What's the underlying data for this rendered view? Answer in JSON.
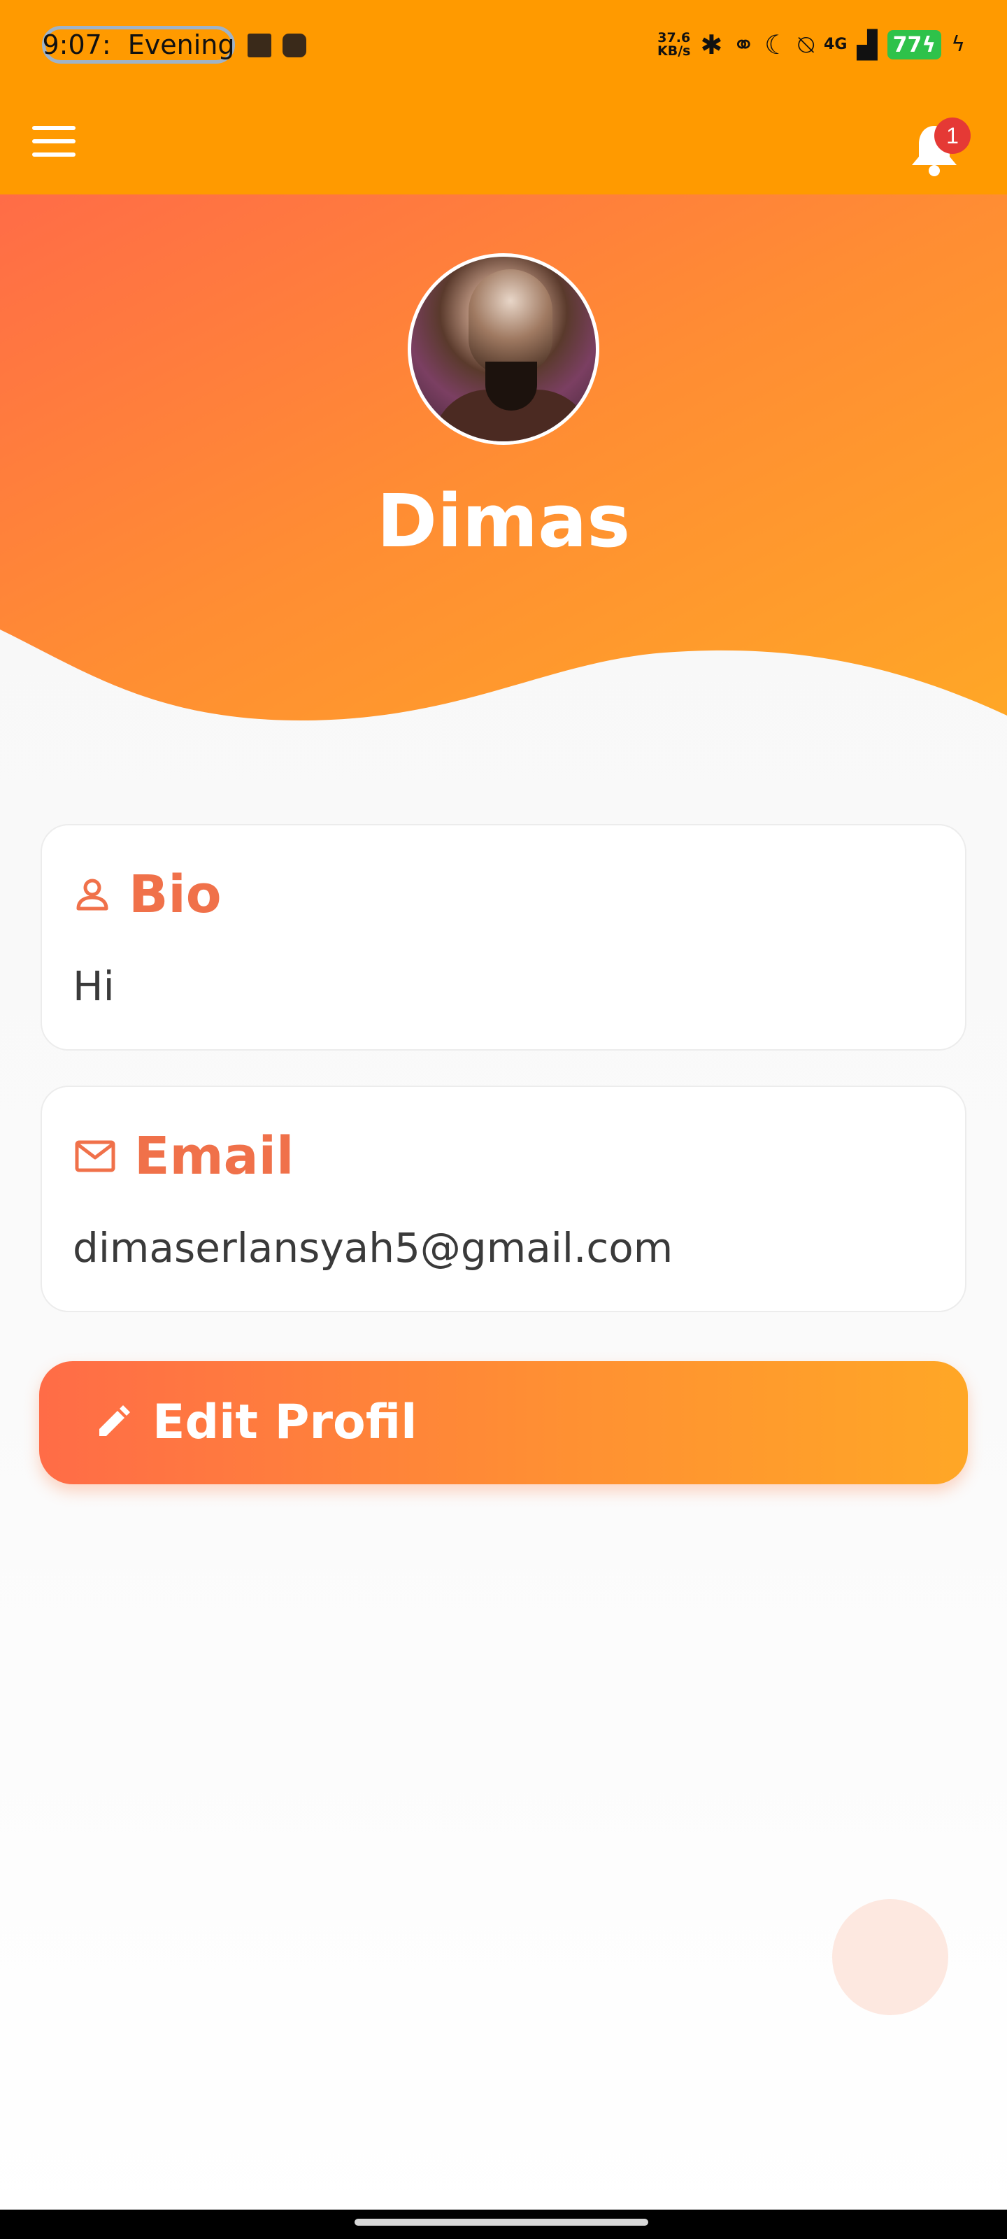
{
  "status_bar": {
    "time": "9:07:  Evening",
    "net_speed_value": "37.6",
    "net_speed_unit": "KB/s",
    "signal": "4G",
    "battery": "77"
  },
  "app_bar": {
    "notification_count": "1"
  },
  "profile": {
    "name": "Dimas"
  },
  "bio_card": {
    "title": "Bio",
    "value": "Hi"
  },
  "email_card": {
    "title": "Email",
    "value": "dimaserlansyah5@gmail.com"
  },
  "edit_button": {
    "label": "Edit Profil"
  },
  "colors": {
    "app_bar": "#ff9a00",
    "accent": "#f0714a",
    "badge": "#e53935",
    "gradient_start": "#ff6c47",
    "gradient_end": "#ffa726"
  }
}
